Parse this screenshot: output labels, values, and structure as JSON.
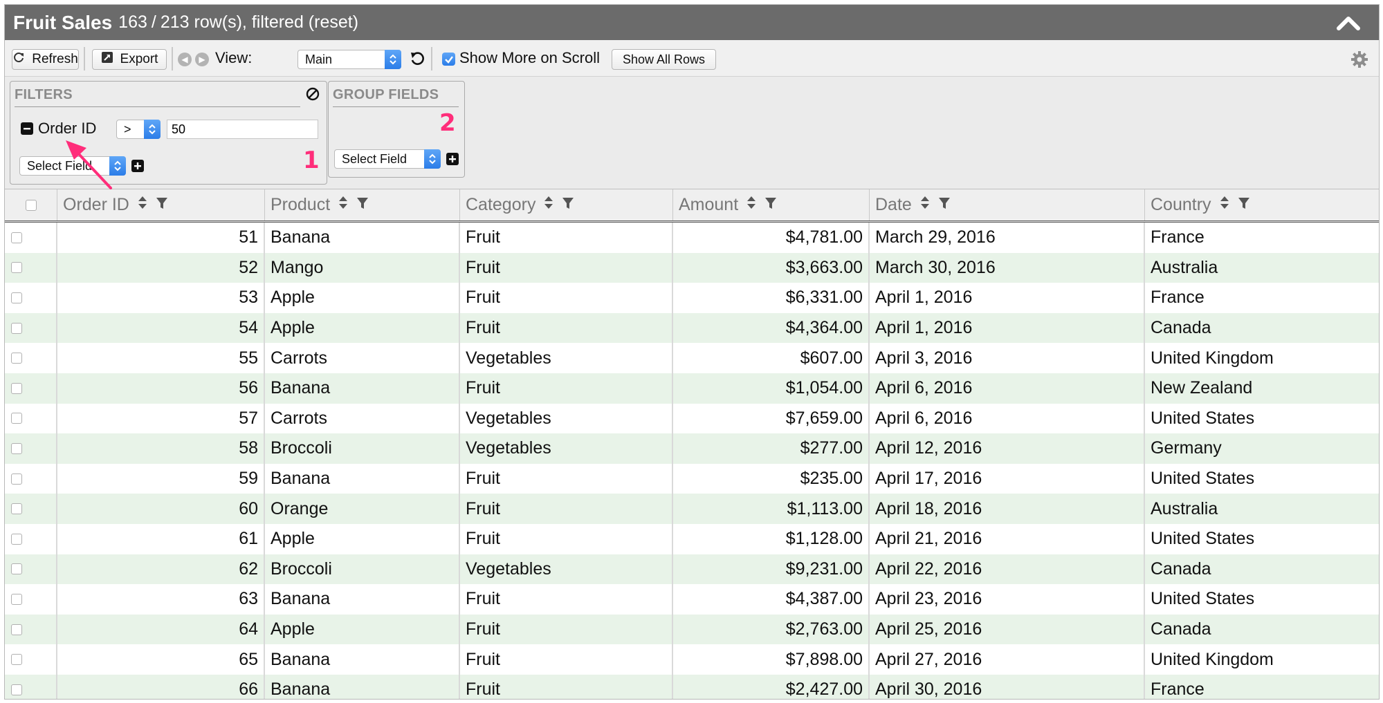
{
  "titlebar": {
    "title": "Fruit Sales",
    "row_count": "163",
    "row_total": "213 row(s), filtered (reset)",
    "separator": "/"
  },
  "toolbar": {
    "refresh_label": "Refresh",
    "export_label": "Export",
    "view_label": "View:",
    "view_value": "Main",
    "show_more_label": "Show More on Scroll",
    "show_more_checked": true,
    "show_all_label": "Show All Rows"
  },
  "filters": {
    "heading": "FILTERS",
    "field_name": "Order ID",
    "operator": ">",
    "value": "50",
    "select_field_label": "Select Field",
    "annotation": "1"
  },
  "group_fields": {
    "heading": "GROUP FIELDS",
    "select_field_label": "Select Field",
    "annotation": "2"
  },
  "table": {
    "columns": [
      "Order ID",
      "Product",
      "Category",
      "Amount",
      "Date",
      "Country"
    ],
    "rows": [
      [
        "51",
        "Banana",
        "Fruit",
        "$4,781.00",
        "March 29, 2016",
        "France"
      ],
      [
        "52",
        "Mango",
        "Fruit",
        "$3,663.00",
        "March 30, 2016",
        "Australia"
      ],
      [
        "53",
        "Apple",
        "Fruit",
        "$6,331.00",
        "April 1, 2016",
        "France"
      ],
      [
        "54",
        "Apple",
        "Fruit",
        "$4,364.00",
        "April 1, 2016",
        "Canada"
      ],
      [
        "55",
        "Carrots",
        "Vegetables",
        "$607.00",
        "April 3, 2016",
        "United Kingdom"
      ],
      [
        "56",
        "Banana",
        "Fruit",
        "$1,054.00",
        "April 6, 2016",
        "New Zealand"
      ],
      [
        "57",
        "Carrots",
        "Vegetables",
        "$7,659.00",
        "April 6, 2016",
        "United States"
      ],
      [
        "58",
        "Broccoli",
        "Vegetables",
        "$277.00",
        "April 12, 2016",
        "Germany"
      ],
      [
        "59",
        "Banana",
        "Fruit",
        "$235.00",
        "April 17, 2016",
        "United States"
      ],
      [
        "60",
        "Orange",
        "Fruit",
        "$1,113.00",
        "April 18, 2016",
        "Australia"
      ],
      [
        "61",
        "Apple",
        "Fruit",
        "$1,128.00",
        "April 21, 2016",
        "United States"
      ],
      [
        "62",
        "Broccoli",
        "Vegetables",
        "$9,231.00",
        "April 22, 2016",
        "Canada"
      ],
      [
        "63",
        "Banana",
        "Fruit",
        "$4,387.00",
        "April 23, 2016",
        "United States"
      ],
      [
        "64",
        "Apple",
        "Fruit",
        "$2,763.00",
        "April 25, 2016",
        "Canada"
      ],
      [
        "65",
        "Banana",
        "Fruit",
        "$7,898.00",
        "April 27, 2016",
        "United Kingdom"
      ],
      [
        "66",
        "Banana",
        "Fruit",
        "$2,427.00",
        "April 30, 2016",
        "France"
      ]
    ]
  },
  "icons": {
    "refresh": "refresh-icon",
    "export": "export-icon",
    "prev": "chevron-left-icon",
    "next": "chevron-right-icon",
    "reset_view": "undo-icon",
    "settings": "gear-icon",
    "collapse": "chevron-up-icon",
    "clear_filters": "clear-icon",
    "sort": "sort-icon",
    "filter": "filter-icon"
  },
  "colors": {
    "titlebar_bg": "#6b6b6b",
    "row_alt_bg": "#e8f3e8",
    "select_accent": "#2b7de8",
    "annotation": "#ff2d7a"
  }
}
